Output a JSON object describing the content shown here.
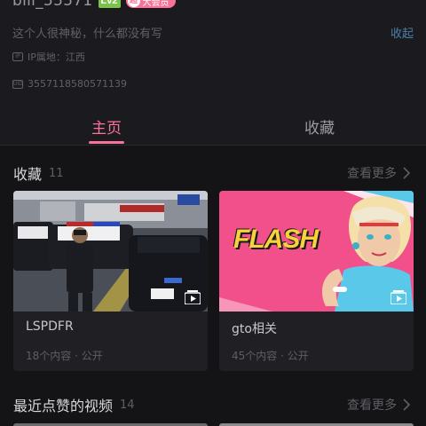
{
  "profile": {
    "username": "bili_55571",
    "level": "Lv2",
    "vip_label": "大会员",
    "vip_icon": "超",
    "bio": "这个人很神秘，什么都没有写",
    "collapse_label": "收起",
    "ip_icon_text": "IP",
    "ip_label": "IP属地：江西",
    "uid_icon_text": "UID",
    "uid": "3557118580571139"
  },
  "tabs": [
    {
      "label": "主页",
      "active": true
    },
    {
      "label": "收藏",
      "active": false
    }
  ],
  "favorites": {
    "title": "收藏",
    "count": "11",
    "see_more": "查看更多",
    "items": [
      {
        "title": "LSPDFR",
        "meta": "18个内容 · 公开"
      },
      {
        "title": "gto相关",
        "meta": "45个内容 · 公开",
        "cover_text": "FLASH"
      }
    ]
  },
  "liked": {
    "title": "最近点赞的视频",
    "count": "14",
    "see_more": "查看更多"
  },
  "colors": {
    "accent": "#fb7299",
    "level_badge": "#7bc44a",
    "background": "#141417",
    "link": "#4a7fa8"
  }
}
